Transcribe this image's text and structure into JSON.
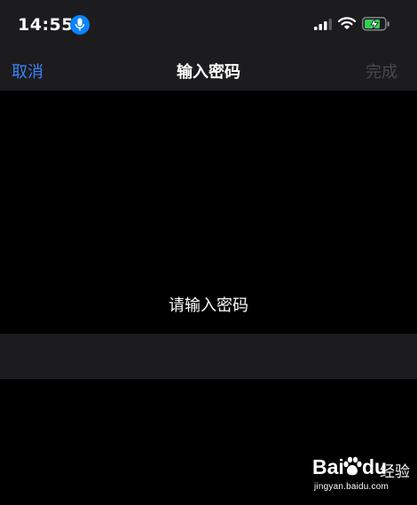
{
  "status_bar": {
    "time": "14:55",
    "mic_indicator": "microphone-icon",
    "signal": "cellular-signal-icon",
    "wifi": "wifi-icon",
    "battery": "battery-charging-icon"
  },
  "nav": {
    "cancel_label": "取消",
    "title": "输入密码",
    "done_label": "完成"
  },
  "main": {
    "prompt": "请输入密码",
    "password_value": ""
  },
  "watermark": {
    "brand_left": "Bai",
    "brand_right": "du",
    "suffix": "经验",
    "url": "jingyan.baidu.com"
  },
  "colors": {
    "accent": "#3a82f7",
    "disabled": "#4a4a4c",
    "bar_background": "#1c1c1e",
    "background": "#000000",
    "mic_badge": "#0a84ff",
    "battery_charge": "#30d158"
  }
}
